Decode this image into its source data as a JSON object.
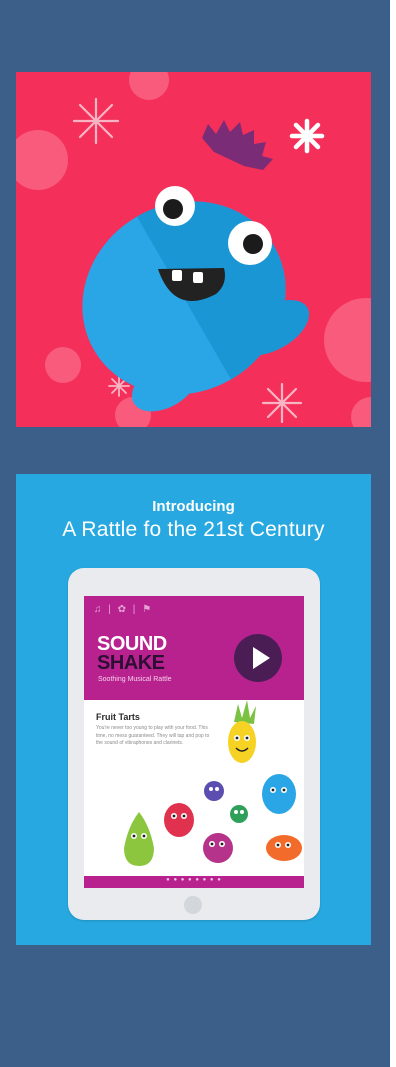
{
  "colors": {
    "panel_bg": "#3c5f8a",
    "icon_bg": "#f4305a",
    "monster_blue": "#2aa5e6",
    "promo_bg": "#27a8e0",
    "header_magenta": "#b8228f",
    "play_button": "#4a1d55"
  },
  "promo": {
    "headline": "Introducing",
    "subheadline": "A Rattle fo the 21st Century"
  },
  "app_screen": {
    "toolbar_icons": "♫ | ✿ | ⚑",
    "brand_line1": "SOUND",
    "brand_line2": "SHAKE",
    "tagline": "Soothing Musical Rattle",
    "content_title": "Fruit Tarts",
    "content_body": "You're never too young to play with your food. This time, no mess guaranteed. They will tap and pop to the sound of vibraphones and clarinets.",
    "page_indicator": "● ● ● ● ● ● ● ●"
  }
}
